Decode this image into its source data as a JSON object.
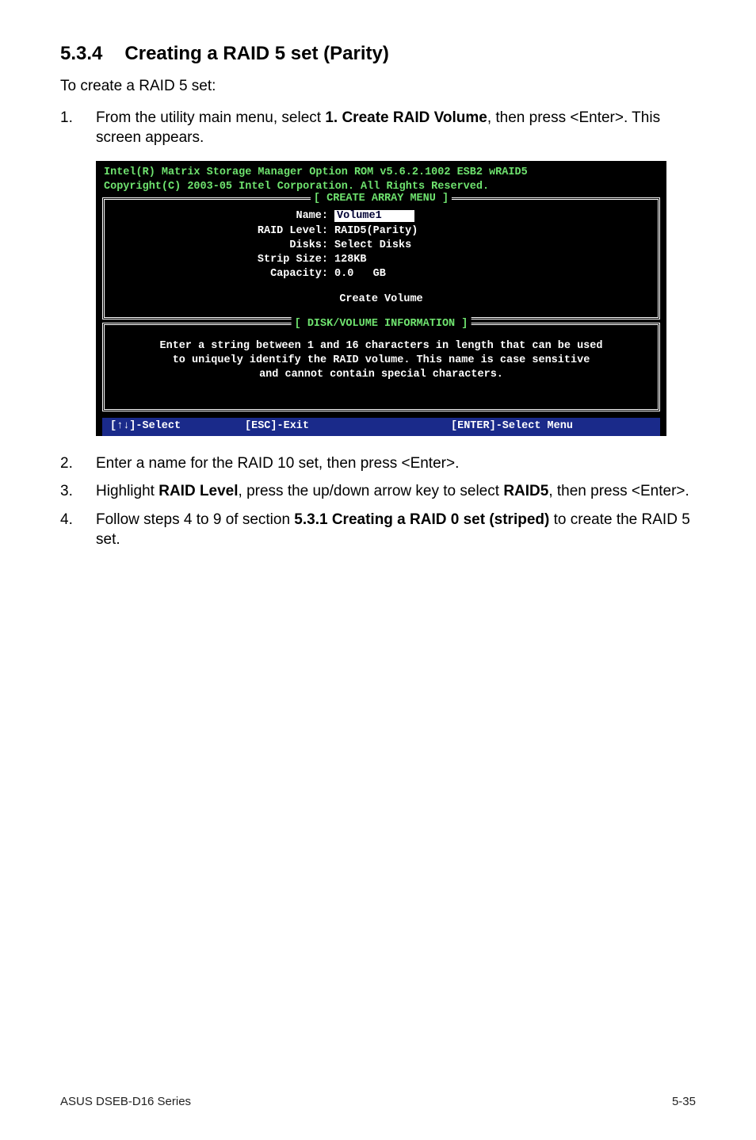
{
  "heading": {
    "number": "5.3.4",
    "title": "Creating a RAID 5 set (Parity)"
  },
  "intro": "To create a RAID 5 set:",
  "steps": {
    "s1": {
      "num": "1.",
      "text_a": "From the utility main menu, select ",
      "bold": "1. Create RAID Volume",
      "text_b": ", then press <Enter>. This screen appears."
    },
    "s2": {
      "num": "2.",
      "text": "Enter a name for the RAID 10 set, then press <Enter>."
    },
    "s3": {
      "num": "3.",
      "text_a": "Highlight ",
      "bold_a": "RAID Level",
      "text_b": ", press the up/down arrow key to select ",
      "bold_b": "RAID5",
      "text_c": ", then press <Enter>."
    },
    "s4": {
      "num": "4.",
      "text_a": "Follow steps 4 to 9 of section ",
      "bold": "5.3.1 Creating a RAID 0 set (striped)",
      "text_b": " to create the RAID 5 set."
    }
  },
  "terminal": {
    "header1": "Intel(R) Matrix Storage Manager Option ROM v5.6.2.1002 ESB2 wRAID5",
    "header2": "Copyright(C) 2003-05 Intel Corporation. All Rights Reserved.",
    "box1_title": "[ CREATE ARRAY MENU ]",
    "fields": {
      "name_k": "Name:",
      "name_v": "Volume1",
      "raid_k": "RAID Level:",
      "raid_v": "RAID5(Parity)",
      "disks_k": "Disks:",
      "disks_v": "Select Disks",
      "strip_k": "Strip Size:",
      "strip_v": "128KB",
      "cap_k": "Capacity:",
      "cap_v": "0.0   GB"
    },
    "create": "Create Volume",
    "box2_title": "[ DISK/VOLUME INFORMATION ]",
    "info1": "Enter a string between 1 and 16 characters in length that can be used",
    "info2": "to uniquely identify the RAID volume. This name is case sensitive",
    "info3": "and cannot contain special characters.",
    "footer": {
      "select": "[↑↓]-Select",
      "exit": "[ESC]-Exit",
      "enter": "[ENTER]-Select Menu"
    }
  },
  "page_footer": {
    "left": "ASUS DSEB-D16 Series",
    "right": "5-35"
  }
}
